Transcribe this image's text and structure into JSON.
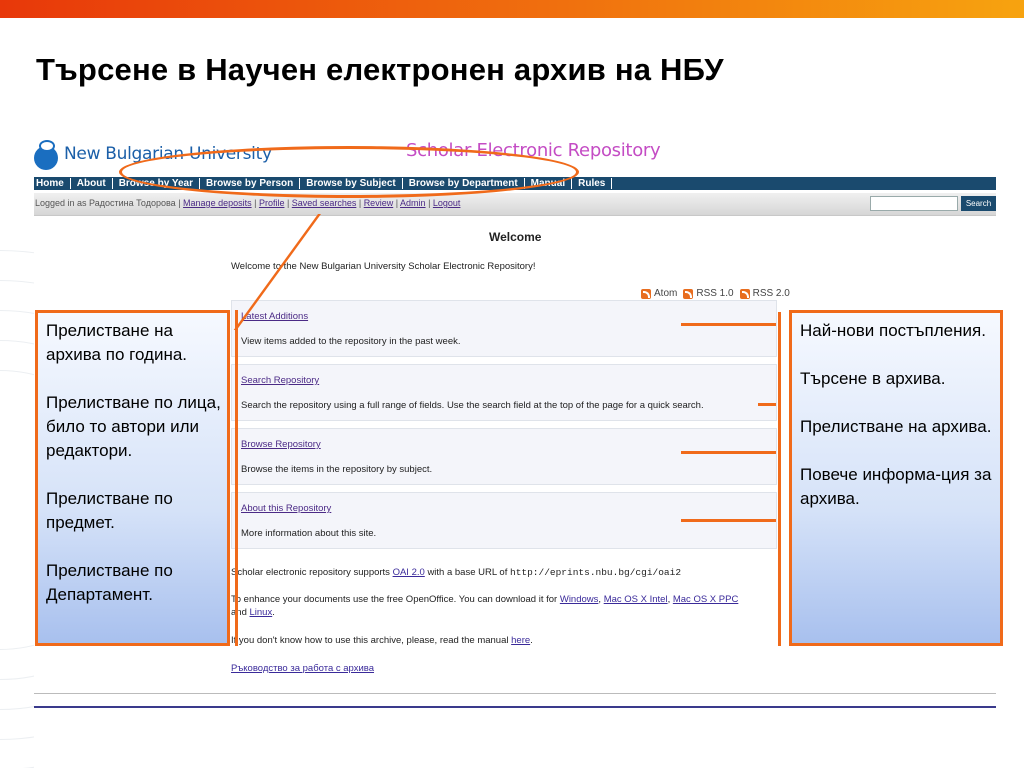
{
  "slide": {
    "title": "Търсене в Научен електронен архив на НБУ"
  },
  "header": {
    "logo_text": "New Bulgarian University",
    "repo_title": "Scholar Electronic Repository"
  },
  "nav": [
    "Home",
    "About",
    "Browse by Year",
    "Browse by Person",
    "Browse by Subject",
    "Browse by Department",
    "Manual",
    "Rules"
  ],
  "userbar": {
    "logged_prefix": "Logged in as Радостина Тодорова |",
    "links": [
      "Manage deposits",
      "Profile",
      "Saved searches",
      "Review",
      "Admin",
      "Logout"
    ],
    "search_button": "Search"
  },
  "main": {
    "welcome_heading": "Welcome",
    "welcome_text": "Welcome to the New Bulgarian University Scholar Electronic Repository!",
    "feeds": [
      "Atom",
      "RSS 1.0",
      "RSS 2.0"
    ],
    "boxes": [
      {
        "title": "Latest Additions",
        "desc": "View items added to the repository in the past week."
      },
      {
        "title": "Search Repository",
        "desc": "Search the repository using a full range of fields. Use the search field at the top of the page for a quick search."
      },
      {
        "title": "Browse Repository",
        "desc": "Browse the items in the repository by subject."
      },
      {
        "title": "About this Repository",
        "desc": "More information about this site."
      }
    ],
    "oai_pre": "Scholar electronic repository supports",
    "oai_link": "OAI 2.0",
    "oai_mid": "with a base URL of",
    "oai_url": "http://eprints.nbu.bg/cgi/oai2",
    "office_pre": "To enhance your documents use the free OpenOffice. You can download it for",
    "office_links": [
      "Windows",
      "Mac OS X Intel",
      "Mac OS X PPC"
    ],
    "office_and": "and",
    "office_last": "Linux",
    "manual_pre": "If you don't know how to use this archive, please, read the manual",
    "manual_link": "here",
    "guide_link": "Ръководство за работа с архива"
  },
  "callouts": {
    "left": "Прелистване на архива по година.\n\nПрелистване по лица, било то автори или редактори.\n\nПрелистване по предмет.\n\nПрелистване по Департамент.",
    "right": "Най-нови постъпления.\n\nТърсене в архива.\n\nПрелистване на архива.\n\nПовече информа-ция за архива."
  },
  "colors": {
    "accent": "#f06a1a",
    "navbar": "#1a4a6e",
    "link": "#4b2a86"
  }
}
